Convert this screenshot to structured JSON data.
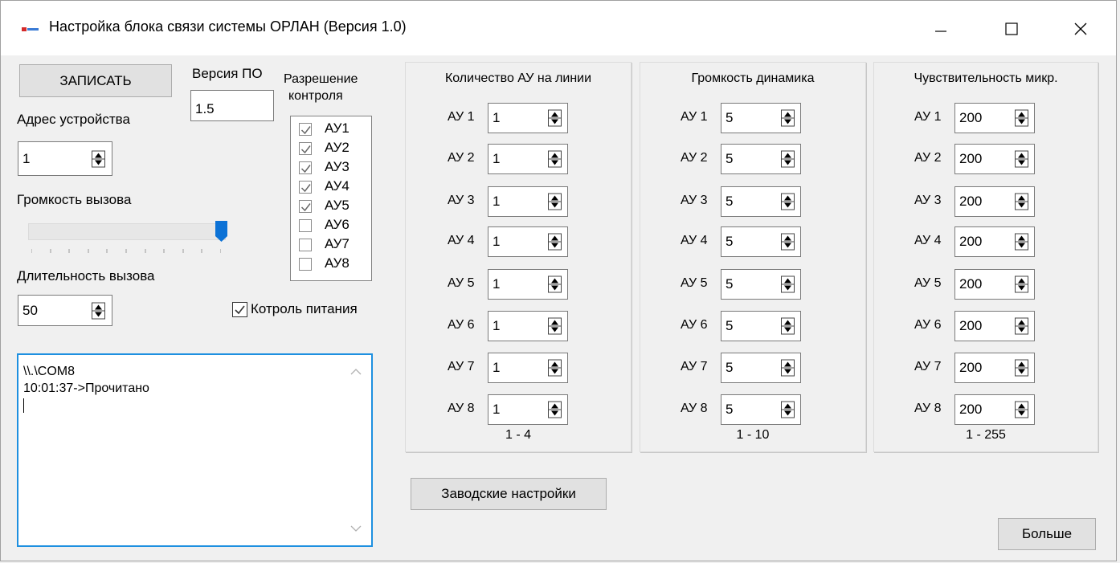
{
  "window": {
    "title": "Настройка блока связи системы ОРЛАН (Версия 1.0)",
    "controls": [
      "minimize-icon",
      "maximize-icon",
      "close-icon"
    ]
  },
  "left": {
    "write_button": "ЗАПИСАТЬ",
    "version_label": "Версия ПО",
    "version_value": "1.5",
    "control_label_line1": "Разрешение",
    "control_label_line2": "контроля",
    "address_label": "Адрес устройства",
    "address_value": "1",
    "call_volume_label": "Громкость вызова",
    "call_volume_level": 10,
    "call_volume_max": 10,
    "call_duration_label": "Длительность вызова",
    "call_duration_value": "50",
    "power_control_label": "Котроль питания",
    "power_control_checked": true
  },
  "control_list": [
    {
      "label": "АУ1",
      "checked": true
    },
    {
      "label": "АУ2",
      "checked": true
    },
    {
      "label": "АУ3",
      "checked": true
    },
    {
      "label": "АУ4",
      "checked": true
    },
    {
      "label": "АУ5",
      "checked": true
    },
    {
      "label": "АУ6",
      "checked": false
    },
    {
      "label": "АУ7",
      "checked": false
    },
    {
      "label": "АУ8",
      "checked": false
    }
  ],
  "log": {
    "line1": "\\\\.\\COM8",
    "line2": "10:01:37->Прочитано"
  },
  "groups": [
    {
      "title": "Количество АУ на линии",
      "range": "1 - 4",
      "rows": [
        {
          "label": "АУ 1",
          "value": "1"
        },
        {
          "label": "АУ 2",
          "value": "1"
        },
        {
          "label": "АУ 3",
          "value": "1"
        },
        {
          "label": "АУ 4",
          "value": "1"
        },
        {
          "label": "АУ 5",
          "value": "1"
        },
        {
          "label": "АУ 6",
          "value": "1"
        },
        {
          "label": "АУ 7",
          "value": "1"
        },
        {
          "label": "АУ 8",
          "value": "1"
        }
      ]
    },
    {
      "title": "Громкость динамика",
      "range": "1 - 10",
      "rows": [
        {
          "label": "АУ 1",
          "value": "5"
        },
        {
          "label": "АУ 2",
          "value": "5"
        },
        {
          "label": "АУ 3",
          "value": "5"
        },
        {
          "label": "АУ 4",
          "value": "5"
        },
        {
          "label": "АУ 5",
          "value": "5"
        },
        {
          "label": "АУ 6",
          "value": "5"
        },
        {
          "label": "АУ 7",
          "value": "5"
        },
        {
          "label": "АУ 8",
          "value": "5"
        }
      ]
    },
    {
      "title": "Чувствительность микр.",
      "range": "1 - 255",
      "rows": [
        {
          "label": "АУ 1",
          "value": "200"
        },
        {
          "label": "АУ 2",
          "value": "200"
        },
        {
          "label": "АУ 3",
          "value": "200"
        },
        {
          "label": "АУ 4",
          "value": "200"
        },
        {
          "label": "АУ 5",
          "value": "200"
        },
        {
          "label": "АУ 6",
          "value": "200"
        },
        {
          "label": "АУ 7",
          "value": "200"
        },
        {
          "label": "АУ 8",
          "value": "200"
        }
      ]
    }
  ],
  "factory_button": "Заводские настройки",
  "more_button": "Больше"
}
